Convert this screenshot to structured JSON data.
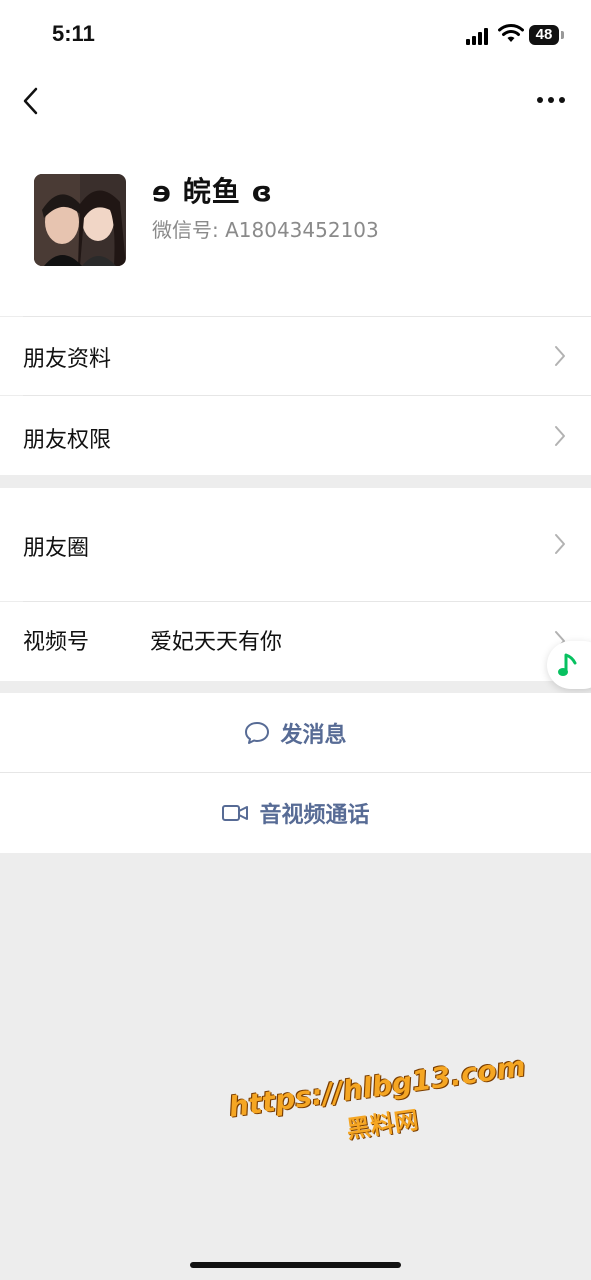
{
  "status_bar": {
    "time": "5:11",
    "battery": "48"
  },
  "profile": {
    "name": "ɘ 皖鱼 ɞ",
    "wechat_id": "微信号: A18043452103"
  },
  "section1": [
    {
      "label": "朋友资料"
    },
    {
      "label": "朋友权限"
    }
  ],
  "section2": {
    "moments": {
      "label": "朋友圈"
    },
    "channels": {
      "label": "视频号",
      "value": "爱妃天天有你"
    }
  },
  "actions": {
    "message": "发消息",
    "call": "音视频通话"
  },
  "watermark": {
    "line1": "https://hlbg13.com",
    "line2": "黑料网"
  },
  "colors": {
    "link": "#576b95",
    "background": "#ededed",
    "music_accent": "#07c160"
  }
}
